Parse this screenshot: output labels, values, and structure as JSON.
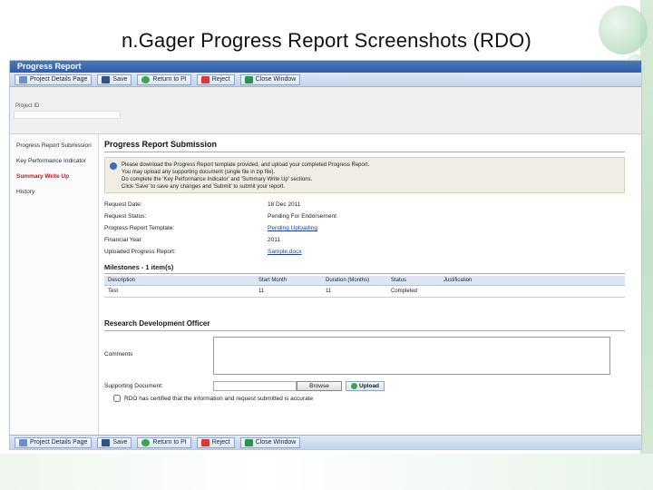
{
  "slide": {
    "title": "n.Gager Progress Report Screenshots (RDO)"
  },
  "window": {
    "title": "Progress Report"
  },
  "toolbar": {
    "buttons": [
      {
        "label": "Project Details Page",
        "icon": "document-icon"
      },
      {
        "label": "Save",
        "icon": "save-icon"
      },
      {
        "label": "Return to PI",
        "icon": "return-icon"
      },
      {
        "label": "Reject",
        "icon": "reject-icon"
      },
      {
        "label": "Close Window",
        "icon": "close-window-icon"
      }
    ]
  },
  "project": {
    "id_label": "Project ID"
  },
  "sidebar": {
    "items": [
      {
        "label": "Progress Report Submission"
      },
      {
        "label": "Key Performance Indicator"
      },
      {
        "label": "Summary Write Up"
      },
      {
        "label": "History"
      }
    ]
  },
  "main": {
    "section_title": "Progress Report Submission",
    "info_lines": [
      "Please download the Progress Report template provided, and upload your completed Progress Report.",
      "You may upload any supporting document (single file in zip file).",
      "Do complete the 'Key Performance Indicator' and 'Summary Write Up' sections.",
      "Click 'Save' to save any changes and 'Submit' to submit your report."
    ],
    "details": [
      {
        "label": "Request Date:",
        "value": "18 Dec 2011"
      },
      {
        "label": "Request Status:",
        "value": "Pending For Endorsement"
      },
      {
        "label": "Progress Report Template:",
        "value": "Pending Uploading"
      },
      {
        "label": "Financial Year:",
        "value": "2011"
      },
      {
        "label": "Uploaded Progress Report:",
        "value": "Sample.docx"
      }
    ],
    "milestones": {
      "title": "Milestones - 1 item(s)",
      "columns": [
        "Description",
        "Start Month",
        "Duration (Months)",
        "Status",
        "Justification"
      ],
      "rows": [
        [
          "Test",
          "11",
          "11",
          "Completed",
          ""
        ]
      ]
    },
    "rdo": {
      "title": "Research Development Officer",
      "comments_label": "Comments",
      "comments_value": "",
      "supporting_label": "Supporting Document:",
      "browse_label": "Browse",
      "upload_label": "Upload",
      "certify_text": "RDO has certified that the information and request submitted is accurate"
    }
  }
}
